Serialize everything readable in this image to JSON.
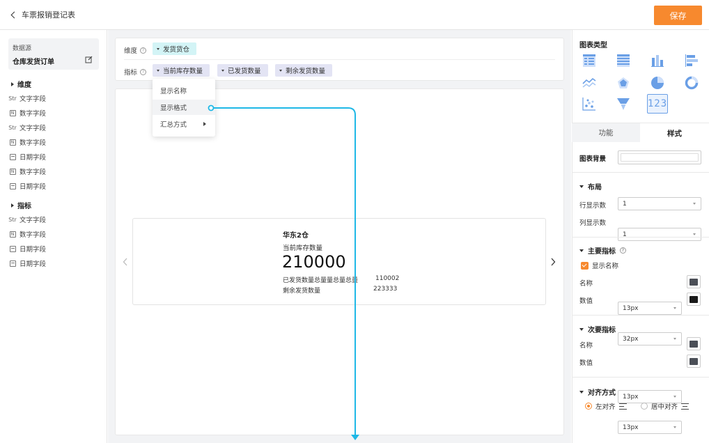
{
  "header": {
    "title": "车票报销登记表",
    "save_label": "保存"
  },
  "sidebar": {
    "datasource_label": "数据源",
    "datasource_name": "仓库发货订单",
    "dim_section": "维度",
    "dim_fields": [
      {
        "type": "Str",
        "label": "文字字段"
      },
      {
        "type": "N",
        "label": "数字字段"
      },
      {
        "type": "Str",
        "label": "文字字段"
      },
      {
        "type": "N",
        "label": "数字字段"
      },
      {
        "type": "date",
        "label": "日期字段"
      },
      {
        "type": "N",
        "label": "数字字段"
      },
      {
        "type": "date",
        "label": "日期字段"
      }
    ],
    "metric_section": "指标",
    "metric_fields": [
      {
        "type": "Str",
        "label": "文字字段"
      },
      {
        "type": "N",
        "label": "数字字段"
      },
      {
        "type": "date",
        "label": "日期字段"
      },
      {
        "type": "date",
        "label": "日期字段"
      }
    ]
  },
  "config": {
    "dimension_label": "维度",
    "dimension_chip": "发货货仓",
    "metric_label": "指标",
    "metric_chips": [
      "当前库存数量",
      "已发货数量",
      "剩余发货数量"
    ],
    "help_glyph": "?"
  },
  "dropdown": {
    "items": [
      "显示名称",
      "显示格式",
      "汇总方式"
    ]
  },
  "card": {
    "warehouse": "华东2仓",
    "metric_name": "当前库存数量",
    "metric_value": "210000",
    "rows": [
      {
        "label": "已发货数量总量量总量总量",
        "value": "110002"
      },
      {
        "label": "剩余发货数量",
        "value": "223333"
      }
    ]
  },
  "right": {
    "chart_type_title": "图表类型",
    "tabs": [
      "功能",
      "样式"
    ],
    "active_tab": "样式",
    "bg_label": "图表背景",
    "layout_title": "布局",
    "rows_label": "行显示数",
    "rows_value": "1",
    "cols_label": "列显示数",
    "cols_value": "1",
    "primary_title": "主要指标",
    "show_name_label": "显示名称",
    "name_label": "名称",
    "primary_name_size": "13px",
    "value_label": "数值",
    "primary_value_size": "32px",
    "secondary_title": "次要指标",
    "secondary_name_size": "13px",
    "secondary_value_size": "13px",
    "align_title": "对齐方式",
    "align_left": "左对齐",
    "align_center": "居中对齐",
    "kpi_icon_text": "123"
  },
  "colors": {
    "accent": "#f7892e",
    "connector": "#1fb8e6",
    "chart_icon": "#6a9fe6",
    "swatch_dark": "#4b4f57",
    "swatch_black": "#1a1a1a"
  }
}
